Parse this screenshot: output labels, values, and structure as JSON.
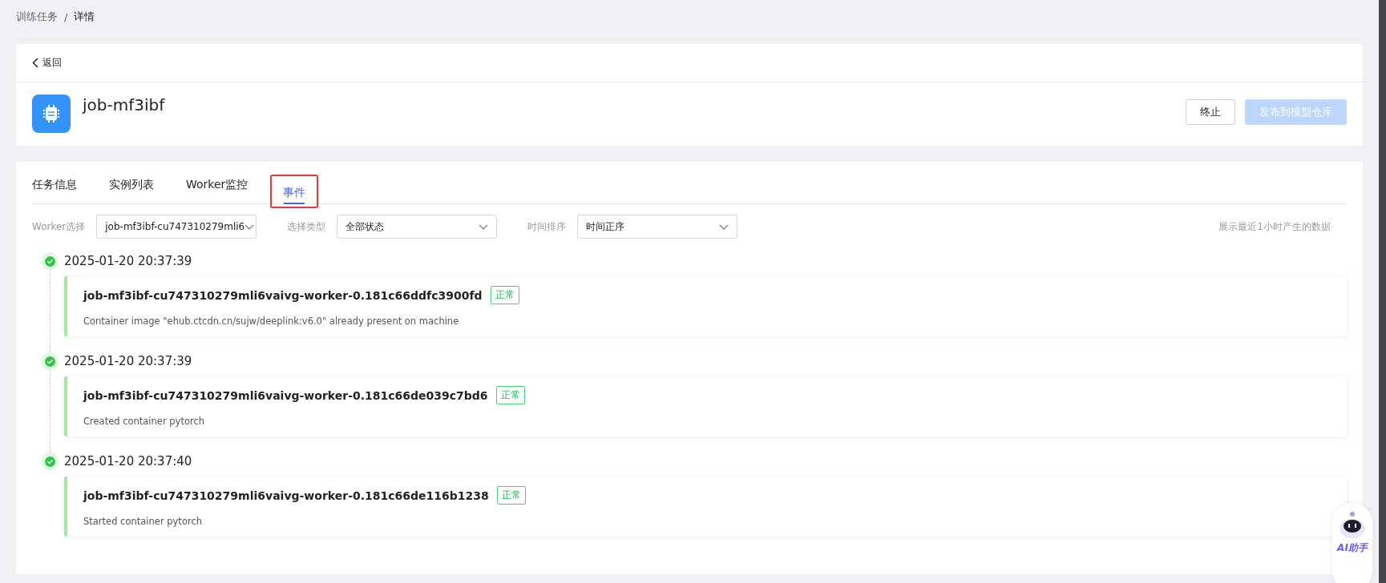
{
  "breadcrumb": {
    "items": [
      {
        "label": "训练任务",
        "current": false
      },
      {
        "label": "详情",
        "current": true
      }
    ],
    "separator": "/"
  },
  "back": {
    "label": "返回"
  },
  "job": {
    "title": "job-mf3ibf"
  },
  "actions": [
    {
      "label": "终止",
      "kind": "default",
      "disabled": false
    },
    {
      "label": "发布到模型仓库",
      "kind": "primary",
      "disabled": true
    }
  ],
  "tabs": [
    {
      "label": "任务信息",
      "selected": false,
      "highlighted": false
    },
    {
      "label": "实例列表",
      "selected": false,
      "highlighted": false
    },
    {
      "label": "Worker监控",
      "selected": false,
      "highlighted": false
    },
    {
      "label": "事件",
      "selected": true,
      "highlighted": true
    }
  ],
  "filters": [
    {
      "label": "Worker选择",
      "value": "job-mf3ibf-cu747310279mli6"
    },
    {
      "label": "选择类型",
      "value": "全部状态"
    },
    {
      "label": "时间排序",
      "value": "时间正序"
    }
  ],
  "note": "展示最近1小时产生的数据",
  "events": [
    {
      "time": "2025-01-20 20:37:39",
      "title": "job-mf3ibf-cu747310279mli6vaivg-worker-0.181c66ddfc3900fd",
      "status": "正常",
      "kind": "normal",
      "message": "Container image \"ehub.ctcdn.cn/sujw/deeplink:v6.0\" already present on machine"
    },
    {
      "time": "2025-01-20 20:37:39",
      "title": "job-mf3ibf-cu747310279mli6vaivg-worker-0.181c66de039c7bd6",
      "status": "正常",
      "kind": "normal",
      "message": "Created container pytorch"
    },
    {
      "time": "2025-01-20 20:37:40",
      "title": "job-mf3ibf-cu747310279mli6vaivg-worker-0.181c66de116b1238",
      "status": "正常",
      "kind": "normal",
      "message": "Started container pytorch"
    }
  ],
  "assistant": {
    "label": "AI助手"
  }
}
